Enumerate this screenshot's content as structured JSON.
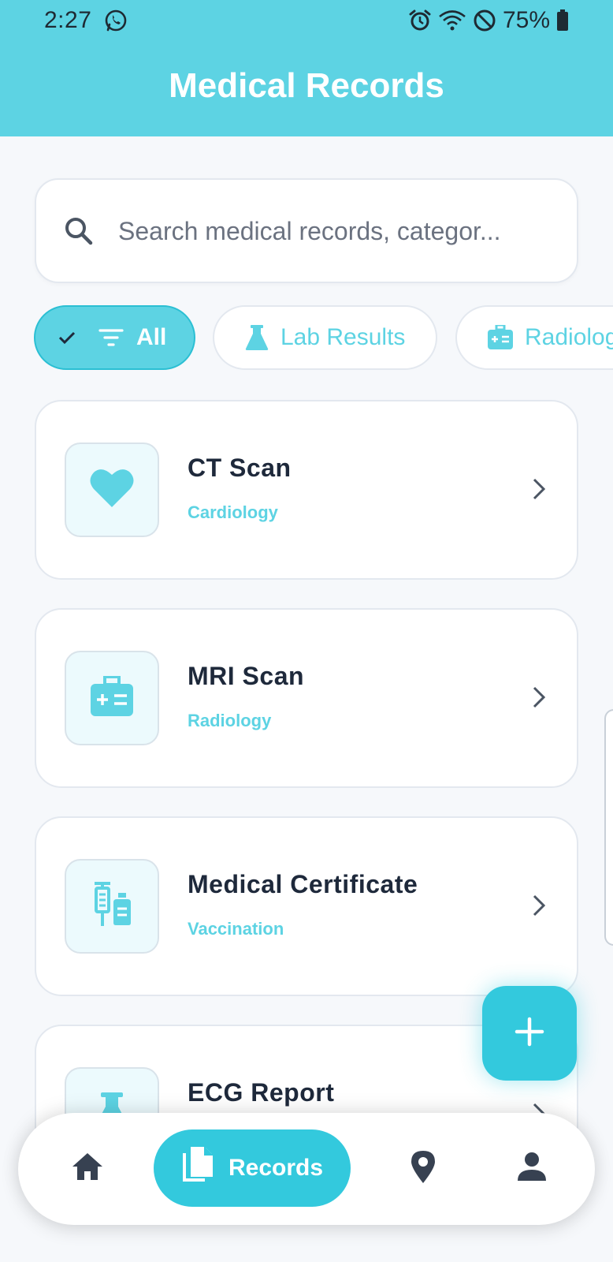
{
  "status_bar": {
    "time": "2:27",
    "battery": "75%",
    "left_icons": [
      "whatsapp-icon"
    ],
    "right_icons": [
      "alarm-icon",
      "wifi-icon",
      "do-not-disturb-icon",
      "battery-icon"
    ]
  },
  "header": {
    "title": "Medical Records",
    "color": "#5dd3e3"
  },
  "search": {
    "placeholder": "Search medical records, categor...",
    "value": ""
  },
  "filters": [
    {
      "label": "All",
      "selected": true,
      "icon": "filter-icon"
    },
    {
      "label": "Lab Results",
      "selected": false,
      "icon": "flask-icon"
    },
    {
      "label": "Radiolog",
      "selected": false,
      "icon": "medical-kit-icon"
    }
  ],
  "records": [
    {
      "title": "CT Scan",
      "category": "Cardiology",
      "icon": "heart-icon"
    },
    {
      "title": "MRI Scan",
      "category": "Radiology",
      "icon": "medical-kit-icon"
    },
    {
      "title": "Medical Certificate",
      "category": "Vaccination",
      "icon": "vaccine-icon"
    },
    {
      "title": "ECG Report",
      "category": "",
      "icon": "flask-icon"
    }
  ],
  "fab": {
    "icon": "plus-icon"
  },
  "bottom_nav": {
    "items": [
      {
        "label": "",
        "icon": "home-icon",
        "active": false
      },
      {
        "label": "Records",
        "icon": "documents-icon",
        "active": true
      },
      {
        "label": "",
        "icon": "location-icon",
        "active": false
      },
      {
        "label": "",
        "icon": "profile-icon",
        "active": false
      }
    ]
  },
  "colors": {
    "accent": "#33c9dd",
    "accent_light": "#5dd3e3",
    "text_dark": "#1e293b"
  }
}
